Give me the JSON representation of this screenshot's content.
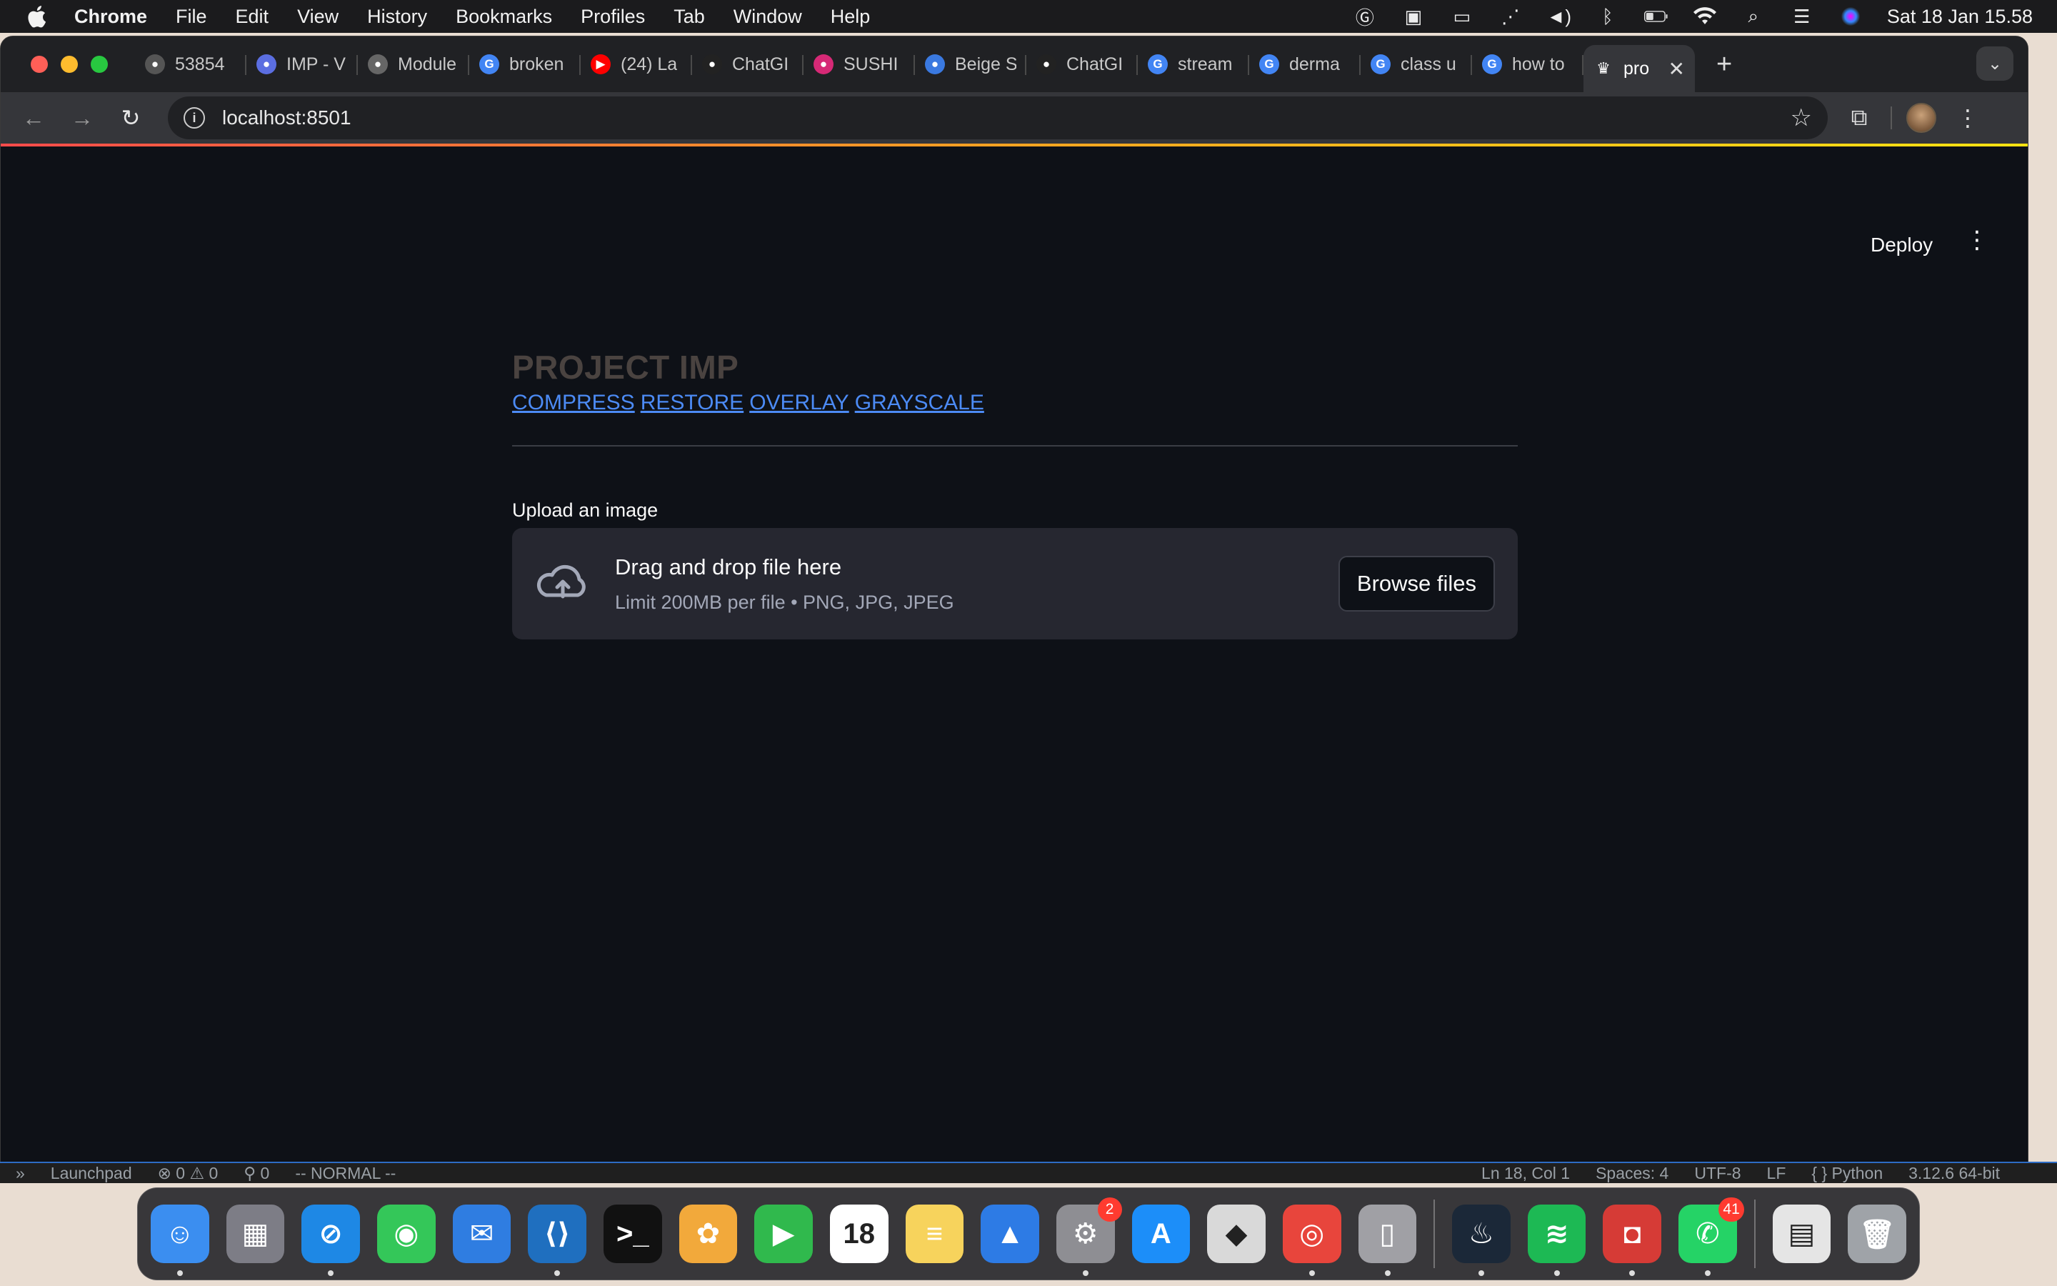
{
  "menubar": {
    "app": "Chrome",
    "items": [
      "File",
      "Edit",
      "View",
      "History",
      "Bookmarks",
      "Profiles",
      "Tab",
      "Window",
      "Help"
    ],
    "clock": "Sat 18 Jan  15.58"
  },
  "tabs": [
    {
      "label": "53854",
      "icon": "cloud-tab-icon",
      "color": "#555555"
    },
    {
      "label": "IMP - V",
      "icon": "calendar-tab-icon",
      "color": "#5b6ee1"
    },
    {
      "label": "Module",
      "icon": "globe-tab-icon",
      "color": "#666666"
    },
    {
      "label": "broken",
      "icon": "google-tab-icon",
      "color": "#4285f4"
    },
    {
      "label": "(24) La",
      "icon": "youtube-tab-icon",
      "color": "#ff0000"
    },
    {
      "label": "ChatGI",
      "icon": "openai-tab-icon",
      "color": "#222222"
    },
    {
      "label": "SUSHI",
      "icon": "instagram-tab-icon",
      "color": "#d62976"
    },
    {
      "label": "Beige S",
      "icon": "canva-tab-icon",
      "color": "#3a79e0"
    },
    {
      "label": "ChatGI",
      "icon": "openai-tab-icon",
      "color": "#222222"
    },
    {
      "label": "stream",
      "icon": "google-tab-icon",
      "color": "#4285f4"
    },
    {
      "label": "derma",
      "icon": "google-tab-icon",
      "color": "#4285f4"
    },
    {
      "label": "class u",
      "icon": "google-tab-icon",
      "color": "#4285f4"
    },
    {
      "label": "how to",
      "icon": "google-tab-icon",
      "color": "#4285f4"
    }
  ],
  "active_tab": {
    "label": "pro",
    "icon": "streamlit-tab-icon"
  },
  "address": "localhost:8501",
  "page": {
    "deploy_label": "Deploy",
    "title": "PROJECT IMP",
    "links": [
      "COMPRESS",
      "RESTORE",
      "OVERLAY",
      "GRAYSCALE"
    ],
    "upload_label": "Upload an image",
    "drop_title": "Drag and drop file here",
    "drop_subtitle": "Limit 200MB per file • PNG, JPG, JPEG",
    "browse_label": "Browse files"
  },
  "statusbar": {
    "left": [
      "Launchpad",
      "⊗ 0 ⚠ 0",
      "⚲ 0",
      "-- NORMAL --"
    ],
    "right": [
      "Ln 18, Col 1",
      "Spaces: 4",
      "UTF-8",
      "LF",
      "{ } Python",
      "3.12.6 64-bit"
    ]
  },
  "dock": [
    {
      "name": "finder",
      "glyph": "☺",
      "color": "#3b8ef0",
      "running": true
    },
    {
      "name": "launchpad",
      "glyph": "▦",
      "color": "#7d7d86",
      "running": false
    },
    {
      "name": "safari",
      "glyph": "⊘",
      "color": "#1e88e5",
      "running": true
    },
    {
      "name": "messages",
      "glyph": "◉",
      "color": "#34c759",
      "running": false
    },
    {
      "name": "mail",
      "glyph": "✉",
      "color": "#2f7de1",
      "running": false
    },
    {
      "name": "vscode",
      "glyph": "⟨⟩",
      "color": "#1f6fbf",
      "running": true
    },
    {
      "name": "terminal",
      "glyph": ">_",
      "color": "#111111",
      "running": false
    },
    {
      "name": "photos",
      "glyph": "✿",
      "color": "#f2a93b",
      "running": false
    },
    {
      "name": "facetime",
      "glyph": "▶",
      "color": "#30b94d",
      "running": false
    },
    {
      "name": "calendar",
      "glyph": "18",
      "color": "#ffffff",
      "running": false
    },
    {
      "name": "notes",
      "glyph": "≡",
      "color": "#f7d35c",
      "running": false
    },
    {
      "name": "keynote",
      "glyph": "▲",
      "color": "#2d7be5",
      "running": false
    },
    {
      "name": "system-settings",
      "glyph": "⚙",
      "color": "#8e8e93",
      "running": true,
      "badge": "2"
    },
    {
      "name": "app-store",
      "glyph": "A",
      "color": "#1c8ef9",
      "running": false
    },
    {
      "name": "roblox",
      "glyph": "◆",
      "color": "#d9d9d9",
      "running": false
    },
    {
      "name": "chrome",
      "glyph": "◎",
      "color": "#e8453c",
      "running": true
    },
    {
      "name": "iphone-mirroring",
      "glyph": "▯",
      "color": "#a0a0a5",
      "running": true
    },
    {
      "name": "steam",
      "glyph": "♨",
      "color": "#1b2838",
      "running": true
    },
    {
      "name": "spotify",
      "glyph": "≋",
      "color": "#1db954",
      "running": true
    },
    {
      "name": "photo-booth",
      "glyph": "◘",
      "color": "#d63b36",
      "running": true
    },
    {
      "name": "whatsapp",
      "glyph": "✆",
      "color": "#25d366",
      "running": true,
      "badge": "41"
    },
    {
      "name": "documents",
      "glyph": "▤",
      "color": "#e5e5e5",
      "running": false
    },
    {
      "name": "trash",
      "glyph": "🗑",
      "color": "#9fa3a8",
      "running": false
    }
  ],
  "colors": {
    "streamlit_bg": "#0e1117",
    "link": "#4c8bf5",
    "dropzone": "#262730"
  }
}
